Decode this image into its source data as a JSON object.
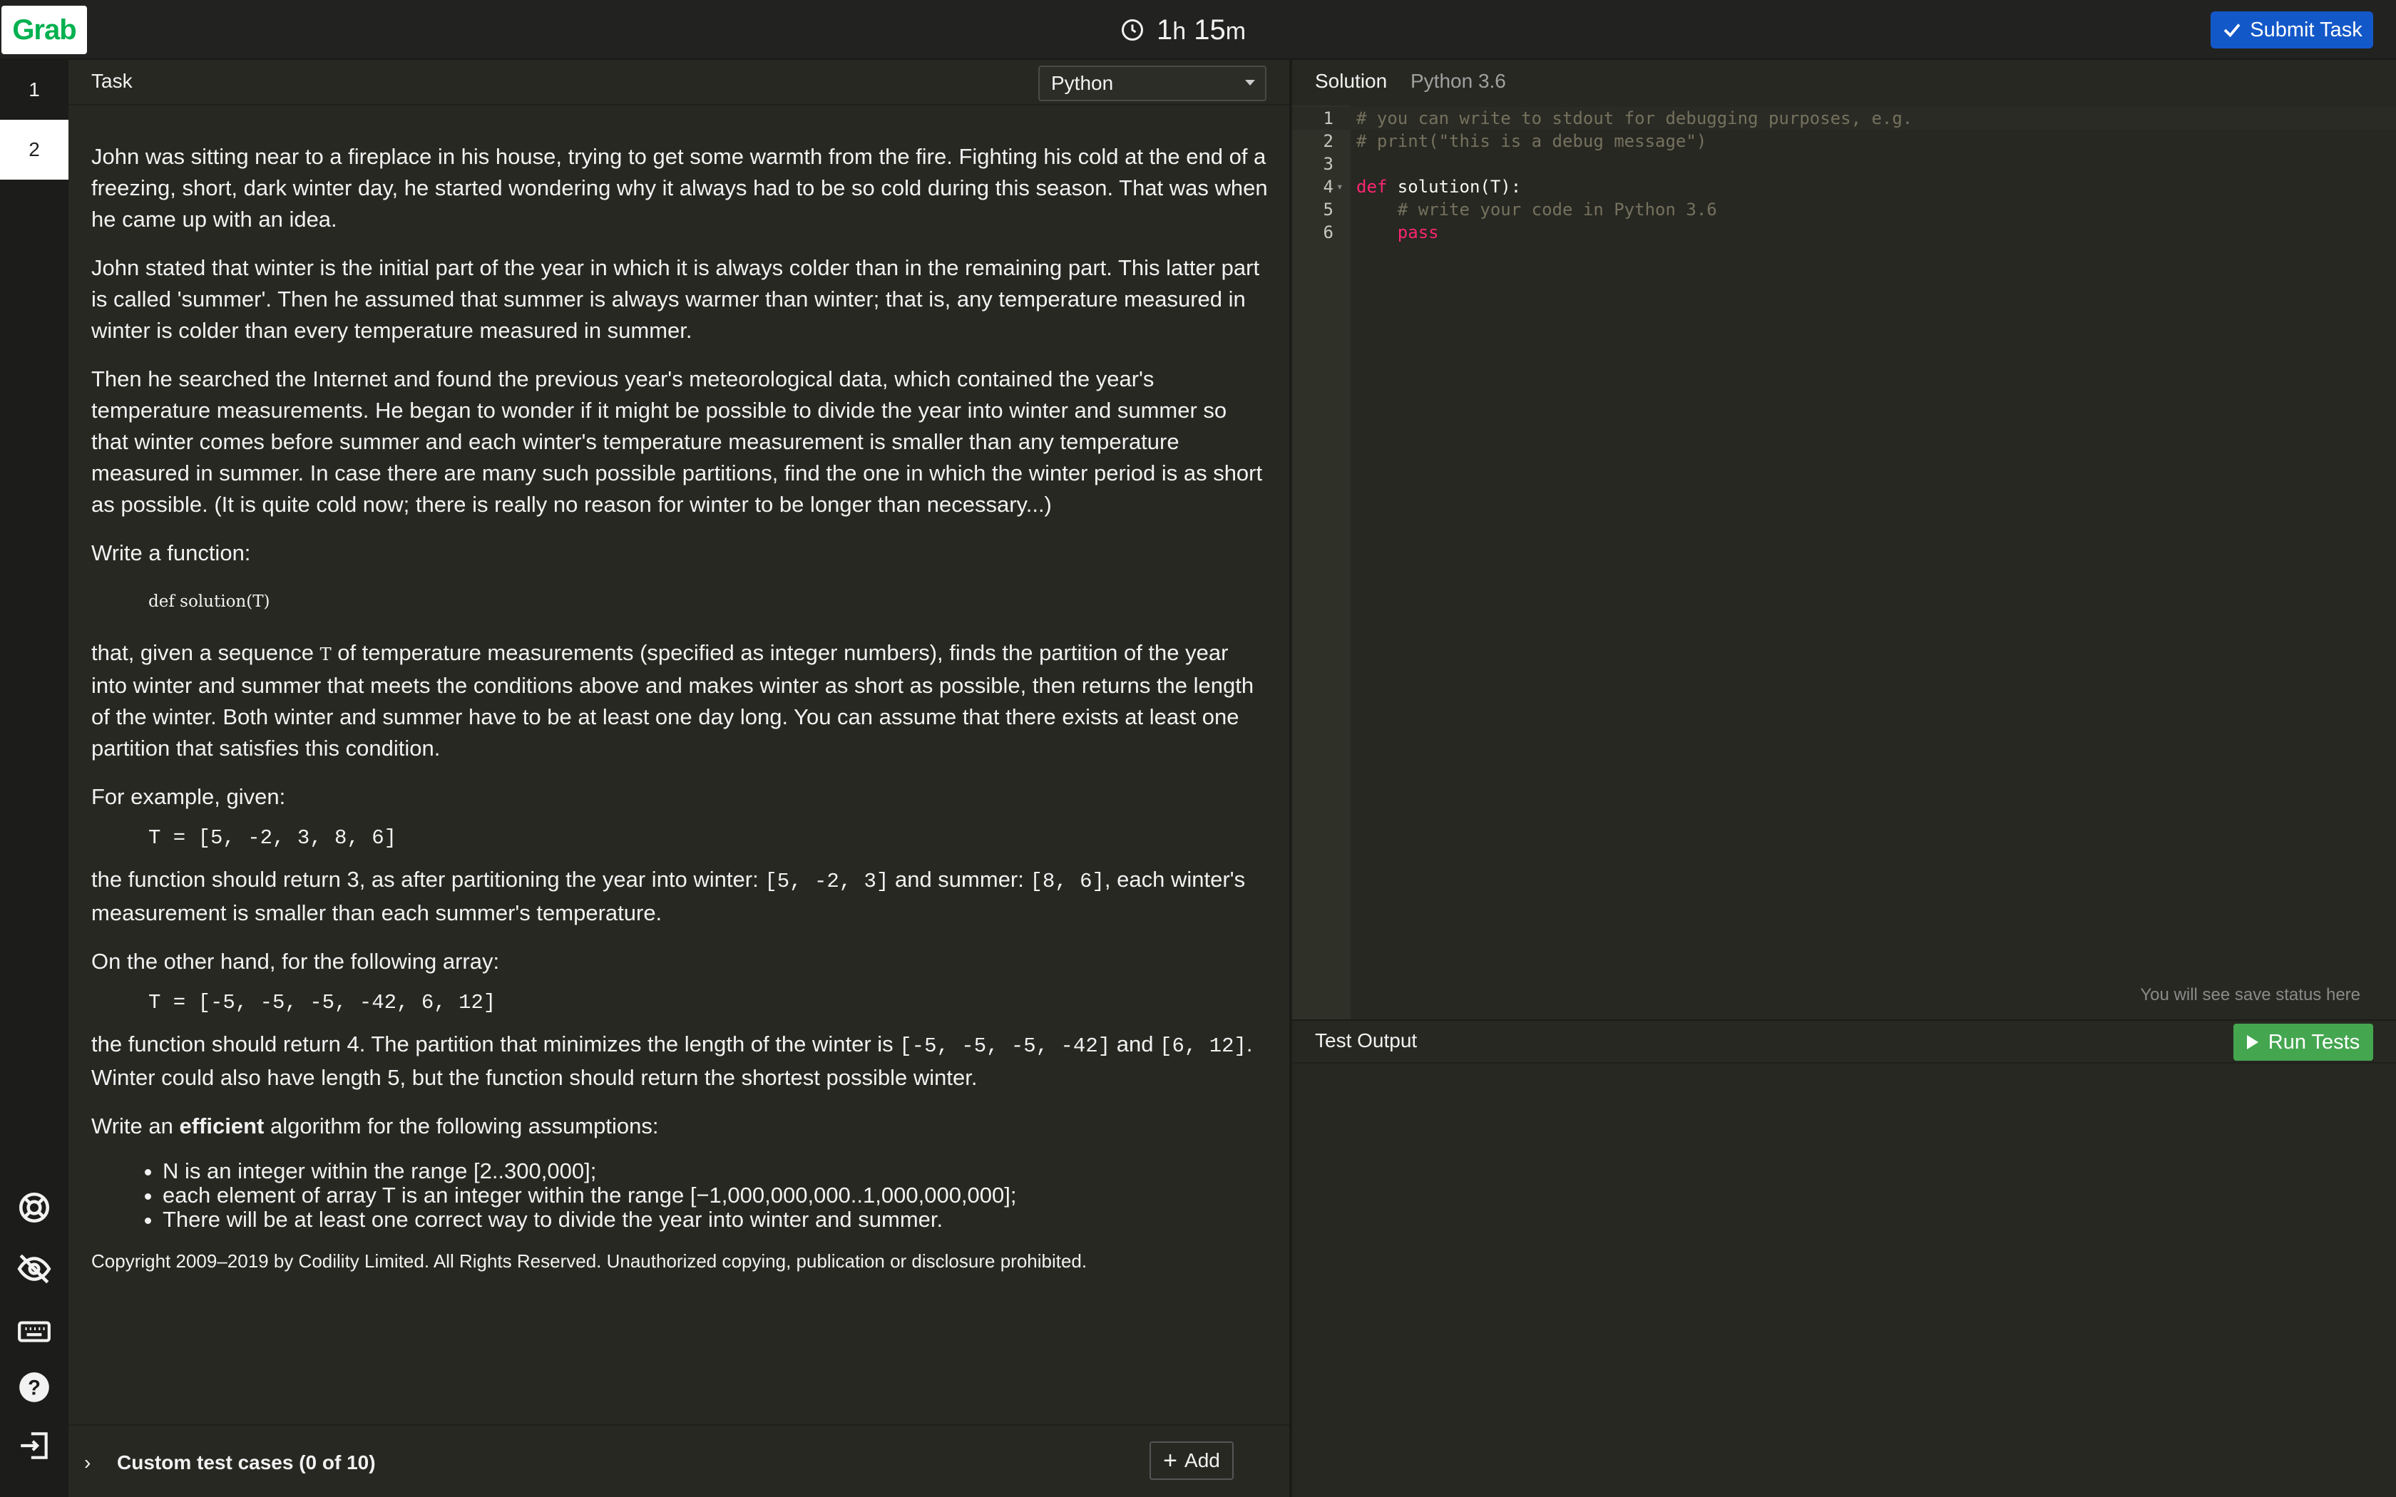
{
  "header": {
    "logo_text": "Grab",
    "timer_hours": "1",
    "timer_hours_unit": "h",
    "timer_minutes": "15",
    "timer_minutes_unit": "m",
    "submit_label": "Submit Task"
  },
  "rail": {
    "tasks": [
      "1",
      "2"
    ],
    "icons": [
      "support-icon",
      "eye-icon",
      "keyboard-icon",
      "help-icon",
      "exit-icon"
    ]
  },
  "task_panel": {
    "title": "Task",
    "language": "Python",
    "paragraphs": {
      "p1": "John was sitting near to a fireplace in his house, trying to get some warmth from the fire. Fighting his cold at the end of a freezing, short, dark winter day, he started wondering why it always had to be so cold during this season. That was when he came up with an idea.",
      "p2": "John stated that winter is the initial part of the year in which it is always colder than in the remaining part. This latter part is called 'summer'. Then he assumed that summer is always warmer than winter; that is, any temperature measured in winter is colder than every temperature measured in summer.",
      "p3": "Then he searched the Internet and found the previous year's meteorological data, which contained the year's temperature measurements. He began to wonder if it might be possible to divide the year into winter and summer so that winter comes before summer and each winter's temperature measurement is smaller than any temperature measured in summer. In case there are many such possible partitions, find the one in which the winter period is as short as possible. (It is quite cold now; there is really no reason for winter to be longer than necessary...)",
      "p4": "Write a function:",
      "sig": "def solution(T)",
      "p5_a": "that, given a sequence ",
      "p5_code": "T",
      "p5_b": " of temperature measurements (specified as integer numbers), finds the partition of the year into winter and summer that meets the conditions above and makes winter as short as possible, then returns the length of the winter. Both winter and summer have to be at least one day long. You can assume that there exists at least one partition that satisfies this condition.",
      "p6": "For example, given:",
      "ex1": "T = [5, -2, 3, 8, 6]",
      "p7_a": "the function should return 3, as after partitioning the year into winter: ",
      "p7_code1": "[5, -2, 3]",
      "p7_b": " and summer: ",
      "p7_code2": "[8, 6]",
      "p7_c": ", each winter's measurement is smaller than each summer's temperature.",
      "p8": "On the other hand, for the following array:",
      "ex2": "T = [-5, -5, -5, -42, 6, 12]",
      "p9_a": "the function should return 4. The partition that minimizes the length of the winter is ",
      "p9_code1": "[-5, -5, -5, -42]",
      "p9_b": " and ",
      "p9_code2": "[6, 12]",
      "p9_c": ". Winter could also have length 5, but the function should return the shortest possible winter.",
      "p10_a": "Write an ",
      "p10_bold": "efficient",
      "p10_b": " algorithm for the following assumptions:",
      "assumptions": [
        "N is an integer within the range [2..300,000];",
        "each element of array T is an integer within the range [−1,000,000,000..1,000,000,000];",
        "There will be at least one correct way to divide the year into winter and summer."
      ],
      "copyright": "Copyright 2009–2019 by Codility Limited. All Rights Reserved. Unauthorized copying, publication or disclosure prohibited."
    },
    "custom_tests_label": "Custom test cases (0 of 10)",
    "add_label": "Add"
  },
  "solution_panel": {
    "title": "Solution",
    "version": "Python 3.6",
    "code": [
      {
        "no": "1",
        "text": "# you can write to stdout for debugging purposes, e.g."
      },
      {
        "no": "2",
        "text": "# print(\"this is a debug message\")"
      },
      {
        "no": "3",
        "text": ""
      },
      {
        "no": "4",
        "kw": "def",
        "text": " solution(T):"
      },
      {
        "no": "5",
        "text": "    # write your code in Python 3.6"
      },
      {
        "no": "6",
        "kw": "    pass",
        "text": ""
      }
    ],
    "save_status": "You will see save status here"
  },
  "test_panel": {
    "title": "Test Output",
    "run_label": "Run Tests"
  },
  "colors": {
    "background": "#272822",
    "submit_button": "#1358c8",
    "run_button": "#45a650",
    "keyword": "#f92672",
    "comment": "#75715e",
    "logo_green": "#00b14f"
  }
}
